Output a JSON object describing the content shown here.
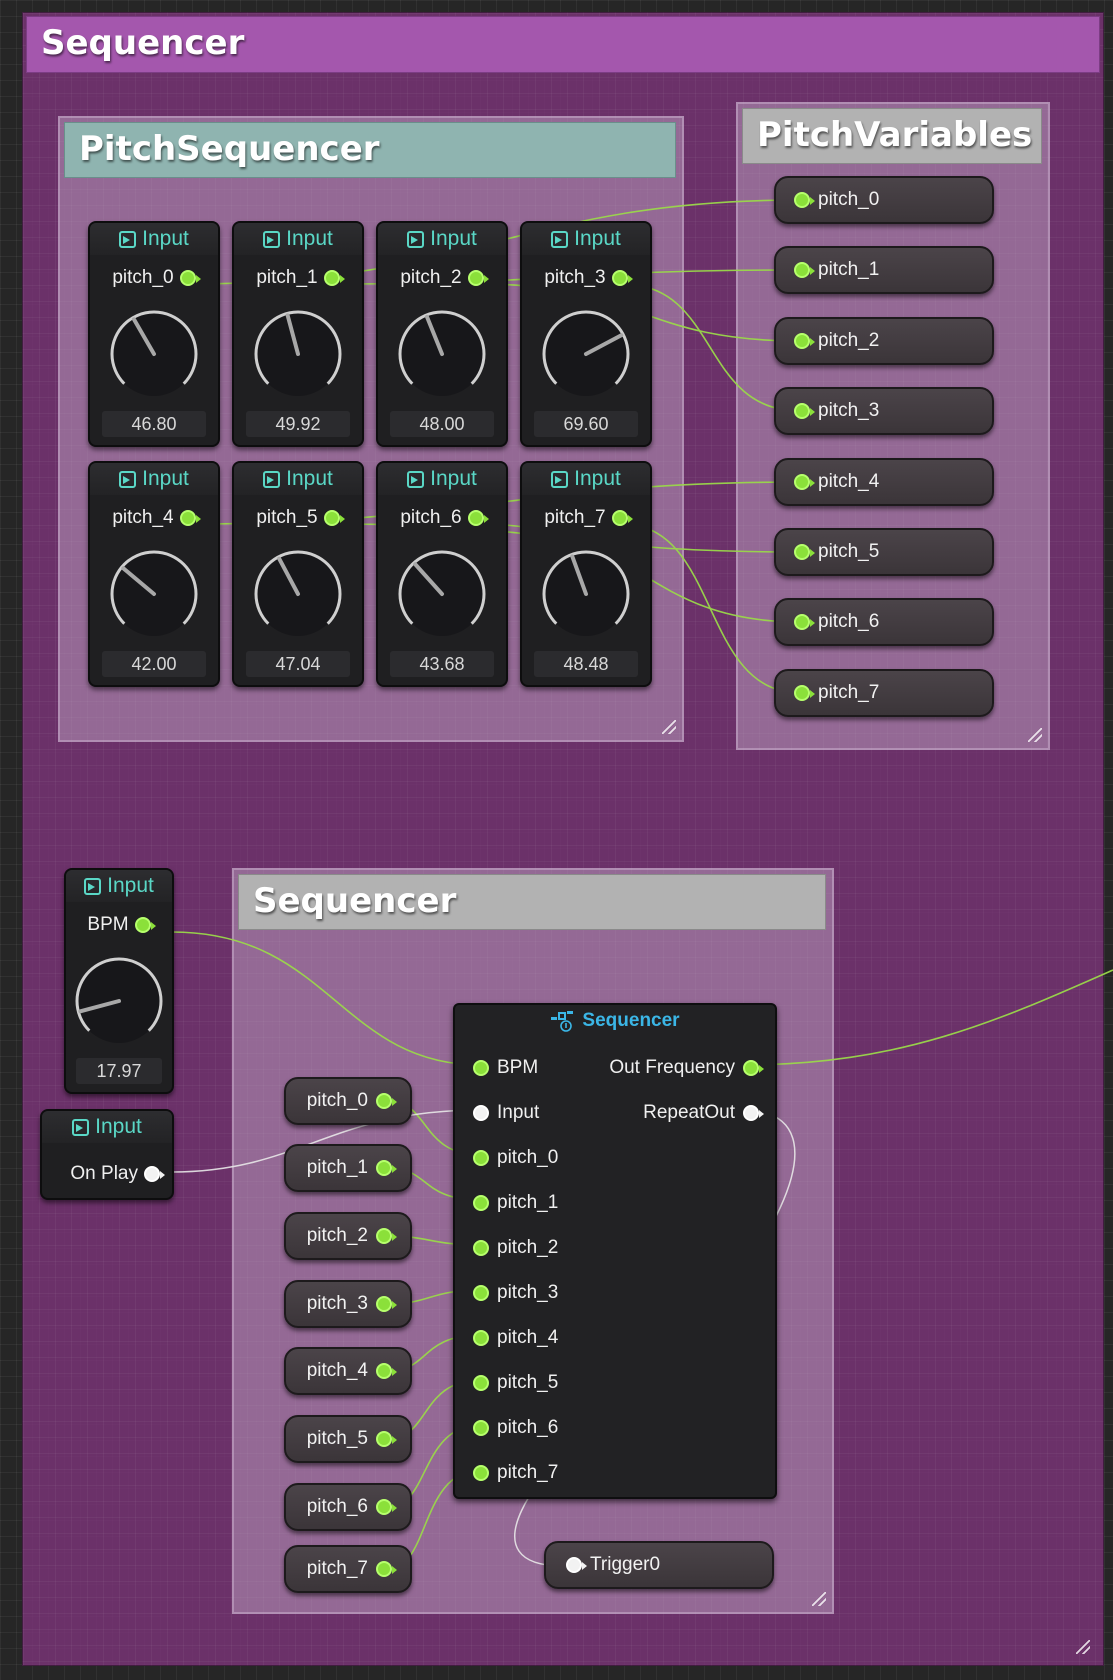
{
  "main_comment": {
    "title": "Sequencer"
  },
  "pitch_sequencer": {
    "title": "PitchSequencer",
    "nodes": [
      {
        "header": "Input",
        "pin": "pitch_0",
        "value": "46.80",
        "angle": -30
      },
      {
        "header": "Input",
        "pin": "pitch_1",
        "value": "49.92",
        "angle": -15
      },
      {
        "header": "Input",
        "pin": "pitch_2",
        "value": "48.00",
        "angle": -22
      },
      {
        "header": "Input",
        "pin": "pitch_3",
        "value": "69.60",
        "angle": 62
      },
      {
        "header": "Input",
        "pin": "pitch_4",
        "value": "42.00",
        "angle": -50
      },
      {
        "header": "Input",
        "pin": "pitch_5",
        "value": "47.04",
        "angle": -28
      },
      {
        "header": "Input",
        "pin": "pitch_6",
        "value": "43.68",
        "angle": -42
      },
      {
        "header": "Input",
        "pin": "pitch_7",
        "value": "48.48",
        "angle": -20
      }
    ]
  },
  "pitch_variables": {
    "title": "PitchVariables",
    "items": [
      "pitch_0",
      "pitch_1",
      "pitch_2",
      "pitch_3",
      "pitch_4",
      "pitch_5",
      "pitch_6",
      "pitch_7"
    ]
  },
  "bpm_node": {
    "header": "Input",
    "pin": "BPM",
    "value": "17.97",
    "angle": -105
  },
  "play_node": {
    "header": "Input",
    "pin": "On Play"
  },
  "sequencer_comment": {
    "title": "Sequencer"
  },
  "sequencer_getters": [
    "pitch_0",
    "pitch_1",
    "pitch_2",
    "pitch_3",
    "pitch_4",
    "pitch_5",
    "pitch_6",
    "pitch_7"
  ],
  "sequencer_node": {
    "title": "Sequencer",
    "inputs": [
      "BPM",
      "Input",
      "pitch_0",
      "pitch_1",
      "pitch_2",
      "pitch_3",
      "pitch_4",
      "pitch_5",
      "pitch_6",
      "pitch_7"
    ],
    "outputs": [
      "Out Frequency",
      "RepeatOut"
    ]
  },
  "trigger_node": {
    "label": "Trigger0"
  },
  "colors": {
    "float_pin": "#8be03a",
    "exec_pin": "#f2f2f2",
    "input_header": "#5ad7c6",
    "sequencer_header": "#3bb6e6",
    "comment_main": "#a457ad",
    "comment_pitchseq": "#8fb4b0",
    "comment_pitchvars": "#b2b2b2",
    "comment_seq": "#b2b2b2"
  }
}
